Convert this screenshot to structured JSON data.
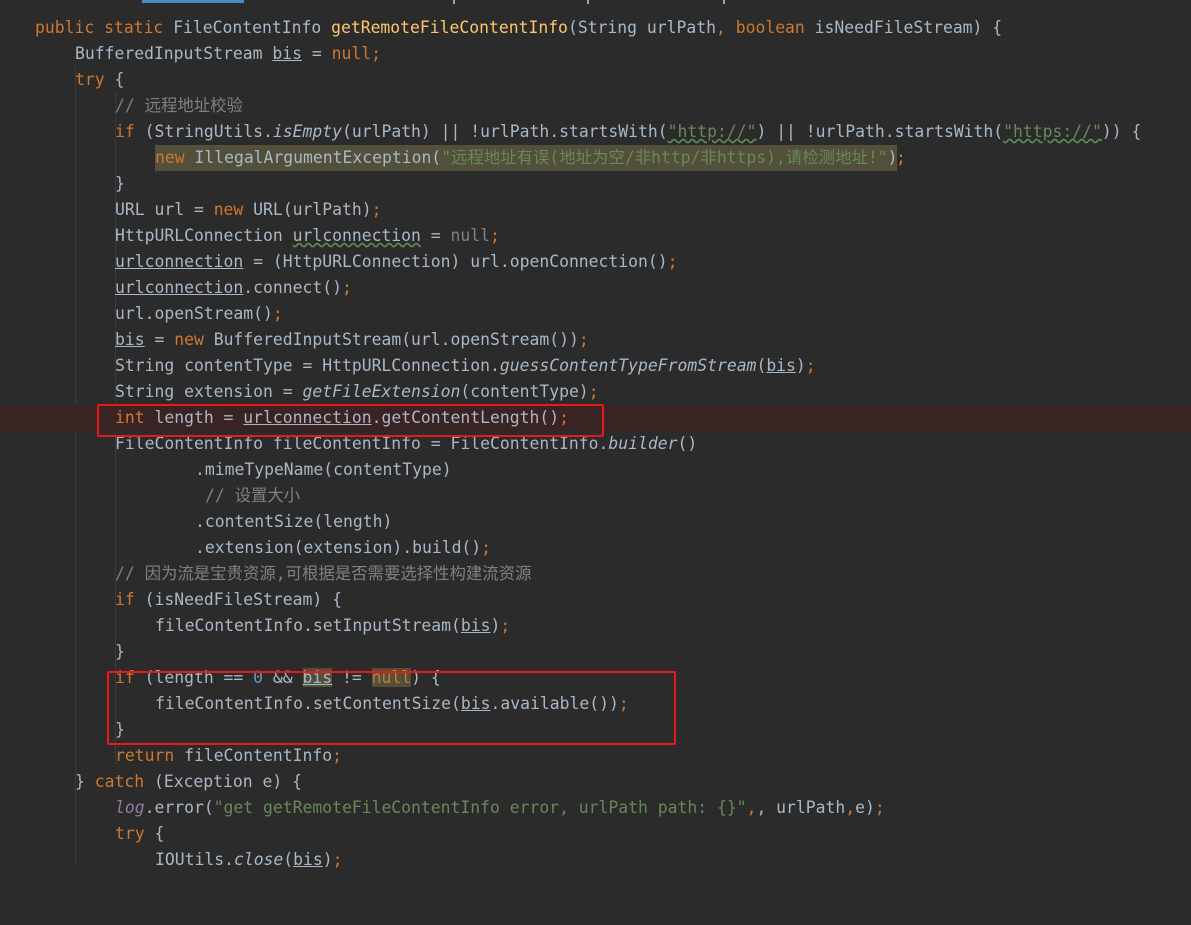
{
  "editor": {
    "colors": {
      "background": "#2b2b2b",
      "keyword": "#cc7832",
      "method_decl": "#ffc66d",
      "string": "#6a8759",
      "comment": "#808080",
      "number": "#6897bb",
      "field": "#9876aa",
      "breakpoint_line": "#3a2323",
      "annotation_box": "#e8191b"
    },
    "tokens": {
      "public": "public",
      "static": "static",
      "type_fci": "FileContentInfo",
      "method_name": "getRemoteFileContentInfo",
      "paren_open": "(",
      "params": "String urlPath",
      "comma": ",",
      "boolean": "boolean",
      "param2": " isNeedFileStream) {",
      "bis_type": "BufferedInputStream ",
      "bis": "bis",
      "assign": " = ",
      "null": "null",
      "semi": ";",
      "try": "try",
      "brace_open": " {",
      "comment1": "// 远程地址校验",
      "if": "if",
      "check_a": " (StringUtils.",
      "isEmpty": "isEmpty",
      "check_b": "(urlPath) || !urlPath.startsWith(",
      "http": "\"http://\"",
      "check_c": ") || !urlPath.startsWith(",
      "https": "\"https://\"",
      "check_d": ")) {",
      "new": "new",
      "exc": " IllegalArgumentException(",
      "exc_msg": "\"远程地址有误(地址为空/非http/非https),请检测地址!\"",
      "close_paren": ")",
      "brace_close": "}",
      "url_a": "URL url = ",
      "url_b": " URL(urlPath)",
      "huc_a": "HttpURLConnection ",
      "urlconnection": "urlconnection",
      "conn_a": " = (HttpURLConnection) url.openConnection()",
      "connect": ".connect()",
      "open_stream": "url.openStream()",
      "bis_new": " BufferedInputStream(url.openStream())",
      "ct_a": "String contentType = HttpURLConnection.",
      "guess": "guessContentTypeFromStream",
      "open_p": "(",
      "close_p": ")",
      "ext_a": "String extension = ",
      "getFileExtension": "getFileExtension",
      "ext_b": "(contentType)",
      "int": "int",
      "len_a": " length = ",
      "len_b": ".getContentLength()",
      "fci_a": "FileContentInfo fileContentInfo = FileContentInfo.",
      "builder": "builder",
      "fci_b": "()",
      "mime": ".mimeTypeName(contentType)",
      "comment2": "// 设置大小",
      "content_size": ".contentSize(length)",
      "ext_build": ".extension(extension).build()",
      "comment3": "// 因为流是宝贵资源,可根据是否需要选择性构建流资源",
      "need_a": " (isNeedFileStream) {",
      "set_is_a": "fileContentInfo.setInputStream(",
      "if_len_a": " (length == ",
      "zero": "0",
      "if_len_b": " && ",
      "ne": " != ",
      "if_len_c": ") {",
      "set_cs_a": "fileContentInfo.setContentSize(",
      "avail": ".available())",
      "return": "return",
      "ret_b": " fileContentInfo",
      "catch_a": "} ",
      "catch": "catch",
      "catch_b": " (Exception e) {",
      "log": "log",
      "err_a": ".error(",
      "err_msg": "\"get getRemoteFileContentInfo error, urlPath path: {}\"",
      "err_b": ", urlPath",
      "err_c": "e)",
      "io_a": "IOUtils.",
      "close": "close"
    }
  }
}
